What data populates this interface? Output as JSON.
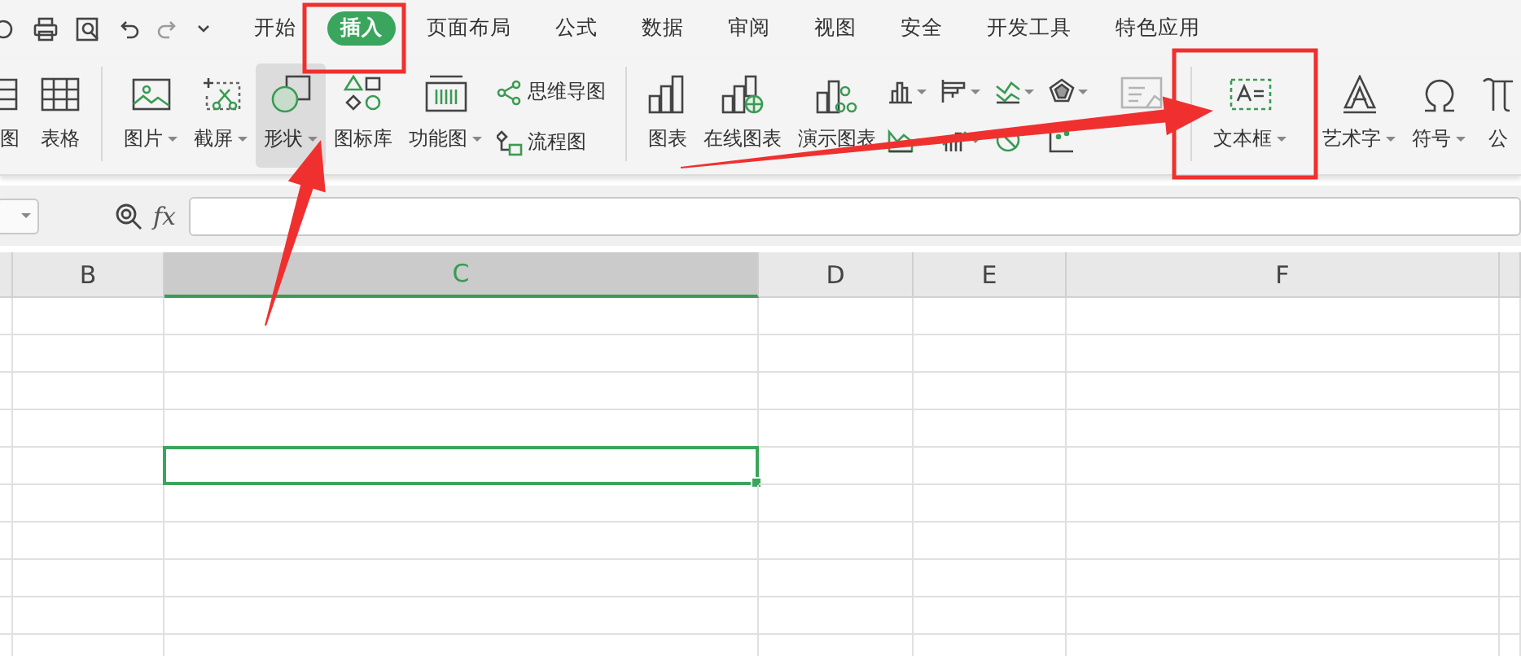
{
  "quick_access": [
    {
      "kind": "circle",
      "disabled": false
    },
    {
      "kind": "print",
      "disabled": false
    },
    {
      "kind": "preview",
      "disabled": false
    },
    {
      "kind": "undo",
      "disabled": false
    },
    {
      "kind": "redo",
      "disabled": true
    },
    {
      "kind": "more",
      "disabled": false
    }
  ],
  "tabs": [
    {
      "label": "开始",
      "selected": false
    },
    {
      "label": "插入",
      "selected": true
    },
    {
      "label": "页面布局",
      "selected": false
    },
    {
      "label": "公式",
      "selected": false
    },
    {
      "label": "数据",
      "selected": false
    },
    {
      "label": "审阅",
      "selected": false
    },
    {
      "label": "视图",
      "selected": false
    },
    {
      "label": "安全",
      "selected": false
    },
    {
      "label": "开发工具",
      "selected": false
    },
    {
      "label": "特色应用",
      "selected": false
    }
  ],
  "ribbon": [
    {
      "kind": "big",
      "label": "图",
      "caret": false,
      "selected": false,
      "disabled": false
    },
    {
      "kind": "big",
      "label": "表格",
      "caret": false,
      "selected": false,
      "disabled": false
    },
    {
      "kind": "divider"
    },
    {
      "kind": "big",
      "label": "图片",
      "caret": true,
      "selected": false,
      "disabled": false
    },
    {
      "kind": "big",
      "label": "截屏",
      "caret": true,
      "selected": false,
      "disabled": false
    },
    {
      "kind": "big",
      "label": "形状",
      "caret": true,
      "selected": true,
      "disabled": false
    },
    {
      "kind": "big",
      "label": "图标库",
      "caret": false,
      "selected": false,
      "disabled": false
    },
    {
      "kind": "big",
      "label": "功能图",
      "caret": true,
      "selected": false,
      "disabled": false
    },
    {
      "kind": "stack",
      "items": [
        {
          "label": "思维导图"
        },
        {
          "label": "流程图"
        }
      ]
    },
    {
      "kind": "divider"
    },
    {
      "kind": "big",
      "label": "图表",
      "caret": false,
      "selected": false,
      "disabled": false
    },
    {
      "kind": "big",
      "label": "在线图表",
      "caret": false,
      "selected": false,
      "disabled": false
    },
    {
      "kind": "big",
      "label": "演示图表",
      "caret": false,
      "selected": false,
      "disabled": false
    },
    {
      "kind": "minis",
      "items": [
        {
          "caret": true
        },
        {
          "caret": true
        },
        {
          "caret": true
        },
        {
          "caret": true
        },
        {
          "caret": true
        },
        {
          "caret": true
        },
        {
          "caret": false
        },
        {
          "caret": false
        }
      ]
    },
    {
      "kind": "big",
      "caret": false,
      "selected": false,
      "disabled": true
    },
    {
      "kind": "divider"
    },
    {
      "kind": "big",
      "label": "文本框",
      "caret": true,
      "selected": false,
      "disabled": false
    },
    {
      "kind": "big",
      "label": "艺术字",
      "caret": true,
      "selected": false,
      "disabled": false
    },
    {
      "kind": "big",
      "label": "符号",
      "caret": true,
      "selected": false,
      "disabled": false
    },
    {
      "kind": "big",
      "label": "公",
      "caret": false,
      "selected": false,
      "disabled": false
    }
  ],
  "formula_bar": {
    "fx": "fx"
  },
  "sheet": {
    "columns": [
      {
        "label": "B",
        "selected": false
      },
      {
        "label": "C",
        "selected": true
      },
      {
        "label": "D",
        "selected": false
      },
      {
        "label": "E",
        "selected": false
      },
      {
        "label": "F",
        "selected": false
      }
    ],
    "rows": [
      {
        "selected": false
      },
      {
        "selected": false
      },
      {
        "selected": false
      },
      {
        "selected": false
      },
      {
        "selected": true
      },
      {
        "selected": false
      },
      {
        "selected": false
      },
      {
        "selected": false
      },
      {
        "selected": false
      },
      {
        "selected": false
      }
    ]
  },
  "annotations": [
    {
      "kind": "box"
    },
    {
      "kind": "box"
    },
    {
      "kind": "arrow"
    },
    {
      "kind": "arrow"
    }
  ]
}
